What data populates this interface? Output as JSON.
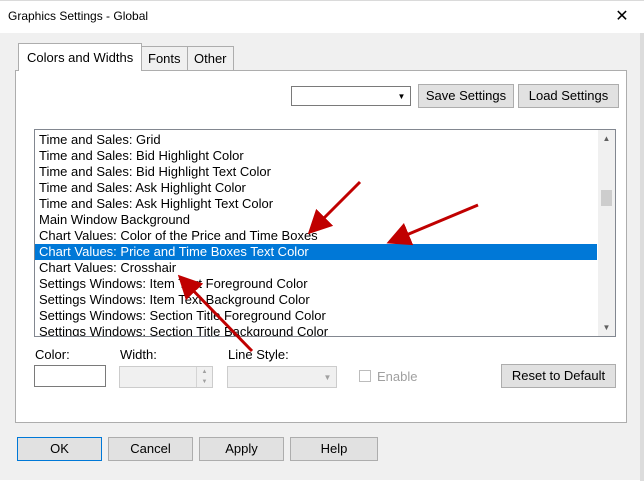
{
  "window": {
    "title": "Graphics Settings - Global",
    "close_glyph": "✕"
  },
  "tabs": [
    {
      "label": "Colors and Widths"
    },
    {
      "label": "Fonts"
    },
    {
      "label": "Other"
    }
  ],
  "settings_combo": {
    "value": "",
    "arrow_icon": "chevron-down-icon"
  },
  "buttons": {
    "save_settings": "Save Settings",
    "load_settings": "Load Settings",
    "reset_to_default": "Reset to Default",
    "ok": "OK",
    "cancel": "Cancel",
    "apply": "Apply",
    "help": "Help"
  },
  "list": {
    "items": [
      {
        "label": "Time and Sales: Grid"
      },
      {
        "label": "Time and Sales: Bid Highlight Color"
      },
      {
        "label": "Time and Sales: Bid Highlight Text Color"
      },
      {
        "label": "Time and Sales: Ask Highlight Color"
      },
      {
        "label": "Time and Sales: Ask Highlight Text Color"
      },
      {
        "label": "Main Window Background"
      },
      {
        "label": "Chart Values: Color of the Price and Time Boxes"
      },
      {
        "label": "Chart Values: Price and Time Boxes Text Color"
      },
      {
        "label": "Chart Values: Crosshair"
      },
      {
        "label": "Settings Windows: Item Text Foreground Color"
      },
      {
        "label": "Settings Windows: Item Text Background Color"
      },
      {
        "label": "Settings Windows: Section Title Foreground Color"
      },
      {
        "label": "Settings Windows: Section Title Background Color"
      }
    ],
    "selected_index": 7,
    "selection_color": "#0078d7"
  },
  "fields": {
    "color_label": "Color:",
    "width_label": "Width:",
    "line_style_label": "Line Style:",
    "enable_label": "Enable",
    "color_value": "#ffffff",
    "width_value": "",
    "line_style_value": "",
    "enable_checked": false
  },
  "annotation": {
    "arrow_color": "#c00000"
  }
}
